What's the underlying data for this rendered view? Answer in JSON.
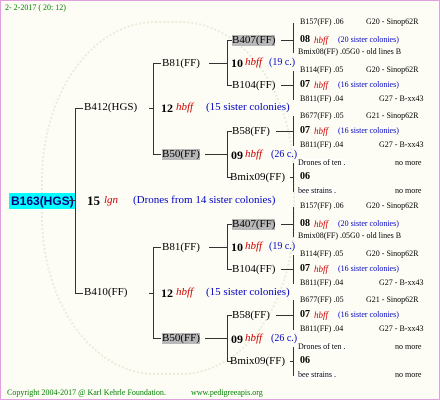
{
  "header": {
    "date": "2- 2-2017 ( 20: 12)"
  },
  "footer": {
    "copyright": "Copyright 2004-2017 @ Karl Kehrle Foundation.",
    "site": "www.pedigreeapis.org"
  },
  "root": {
    "id": "B163(HGS)",
    "num": "15",
    "sym": "lgn",
    "note": "(Drones from 14 sister colonies)"
  },
  "g1": [
    {
      "id": "B412(HGS)",
      "num": "12",
      "sym": "hbff",
      "note": "(15 sister colonies)"
    },
    {
      "id": "B410(FF)",
      "num": "12",
      "sym": "hbff",
      "note": "(15 sister colonies)"
    }
  ],
  "g2": [
    {
      "id": "B81(FF)",
      "num": "10",
      "sym": "hbff",
      "note": "(19 c.)"
    },
    {
      "id": "B50(FF)",
      "num": "09",
      "sym": "hbff",
      "note": "(26 c.)"
    },
    {
      "id": "B81(FF)",
      "num": "10",
      "sym": "hbff",
      "note": "(19 c.)"
    },
    {
      "id": "B50(FF)",
      "num": "09",
      "sym": "hbff",
      "note": "(26 c.)"
    }
  ],
  "g3": [
    {
      "id": "B407(FF)",
      "num": "08",
      "sym": "hbff",
      "note": "(20 sister colonies)"
    },
    {
      "id": "B104(FF)",
      "num": "07",
      "sym": "hbff",
      "note": "(16 sister colonies)"
    },
    {
      "id": "B58(FF)",
      "num": "07",
      "sym": "hbff",
      "note": "(16 sister colonies)"
    },
    {
      "id": "Bmix09(FF)",
      "num": "06",
      "sym": "",
      "note": ""
    },
    {
      "id": "B407(FF)",
      "num": "08",
      "sym": "hbff",
      "note": "(20 sister colonies)"
    },
    {
      "id": "B104(FF)",
      "num": "07",
      "sym": "hbff",
      "note": "(16 sister colonies)"
    },
    {
      "id": "B58(FF)",
      "num": "07",
      "sym": "hbff",
      "note": "(16 sister colonies)"
    },
    {
      "id": "Bmix09(FF)",
      "num": "06",
      "sym": "",
      "note": ""
    }
  ],
  "g4": [
    {
      "id": "B157(FF) .06",
      "extra": "G20 - Sinop62R"
    },
    {
      "id": "Bmix08(FF) .05G0 - old lines B",
      "extra": ""
    },
    {
      "id": "B114(FF) .05",
      "extra": "G20 - Sinop62R"
    },
    {
      "id": "B811(FF) .04",
      "extra": "G27 - B-xx43"
    },
    {
      "id": "B677(FF) .05",
      "extra": "G21 - Sinop62R"
    },
    {
      "id": "B811(FF) .04",
      "extra": "G27 - B-xx43"
    },
    {
      "id": "Drones of ten .",
      "extra": "no more"
    },
    {
      "id": "bee strains .",
      "extra": "no more"
    },
    {
      "id": "B157(FF) .06",
      "extra": "G20 - Sinop62R"
    },
    {
      "id": "Bmix08(FF) .05G0 - old lines B",
      "extra": ""
    },
    {
      "id": "B114(FF) .05",
      "extra": "G20 - Sinop62R"
    },
    {
      "id": "B811(FF) .04",
      "extra": "G27 - B-xx43"
    },
    {
      "id": "B677(FF) .05",
      "extra": "G21 - Sinop62R"
    },
    {
      "id": "B811(FF) .04",
      "extra": "G27 - B-xx43"
    },
    {
      "id": "Drones of ten .",
      "extra": "no more"
    },
    {
      "id": "bee strains .",
      "extra": "no more"
    }
  ]
}
